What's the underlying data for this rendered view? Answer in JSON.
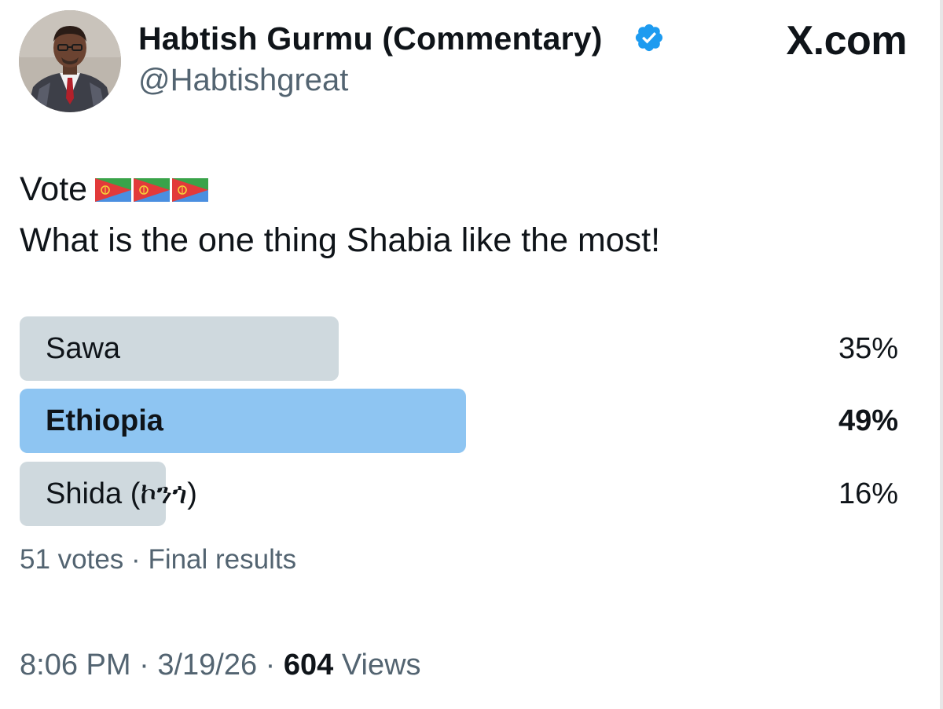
{
  "header": {
    "display_name": "Habtish Gurmu (Commentary)",
    "handle": "@Habtishgreat",
    "brand": "X.com",
    "verified_icon": "verified-badge-icon"
  },
  "tweet": {
    "line1": "Vote",
    "flag_emoji_count": 3,
    "flag_icon": "eritrea-flag-icon",
    "line2": "What is the one thing Shabia like the most!"
  },
  "poll": {
    "options": [
      {
        "label": "Sawa",
        "percent_text": "35%",
        "percent": 35,
        "winner": false
      },
      {
        "label": "Ethiopia",
        "percent_text": "49%",
        "percent": 49,
        "winner": true
      },
      {
        "label": "Shida (ኮንጎ)",
        "percent_text": "16%",
        "percent": 16,
        "winner": false
      }
    ],
    "votes": "51 votes",
    "separator": "·",
    "status": "Final results"
  },
  "footer": {
    "time": "8:06 PM",
    "date": "3/19/26",
    "separator": "·",
    "views_count": "604",
    "views_label": "Views"
  },
  "colors": {
    "winner_fill": "#8ec5f2",
    "loser_fill": "#cfd9de",
    "text": "#0f1419",
    "secondary": "#536471",
    "verified": "#1d9bf0"
  }
}
